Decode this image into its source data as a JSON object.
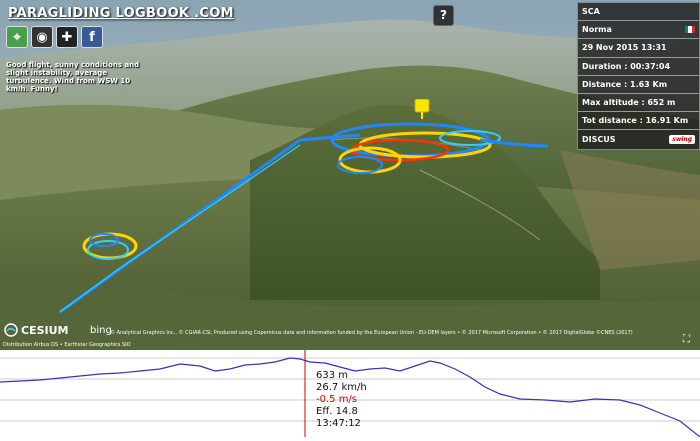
{
  "site": {
    "title": "PARAGLIDING LOGBOOK .COM"
  },
  "app_icons": [
    {
      "name": "maps-icon",
      "color": "#4aa04a",
      "glyph": "⌖"
    },
    {
      "name": "tracker-icon",
      "color": "#333333",
      "glyph": "◉"
    },
    {
      "name": "gamepad-icon",
      "color": "#222222",
      "glyph": "✚"
    },
    {
      "name": "facebook-icon",
      "color": "#3b5998",
      "glyph": "f"
    }
  ],
  "description": "Good flight, sunny conditions and slight instability, average turbulence. Wind from WSW 10 km/h. Funny!",
  "help_label": "?",
  "info": {
    "pilot": "SCA",
    "site": "Norma",
    "datetime": "29 Nov 2015 13:31",
    "duration": "Duration : 00:37:04",
    "distance": "Distance : 1.63 Km",
    "max_altitude": "Max altitude : 652 m",
    "tot_distance": "Tot distance : 16.91 Km",
    "wing": "DISCUS",
    "brand": "swing",
    "flag_colors": [
      "#009246",
      "#ffffff",
      "#ce2b37"
    ]
  },
  "footer": {
    "cesium": "CESIUM",
    "bing": "bing",
    "credits": "© Analytical Graphics Inc., © CGIAR-CSI, Produced using Copernicus data and information funded by the European Union - EU-DEM layers • © 2017 Microsoft Corporation • © 2017 DigitalGlobe ©CNES (2017)",
    "credits2": "Distribution Airbus DS • Earthstar Geographics SIO"
  },
  "readout": {
    "altitude": "633 m",
    "speed": "26.7 km/h",
    "vario": "-0.5 m/s",
    "efficiency": "Eff. 14.8",
    "time": "13:47:12"
  },
  "colors": {
    "profile_line": "#3333bb",
    "cursor_line": "#cc0000",
    "track_cool": "#1e88ff",
    "track_warm": "#ffd400",
    "track_hot": "#ff3300"
  }
}
